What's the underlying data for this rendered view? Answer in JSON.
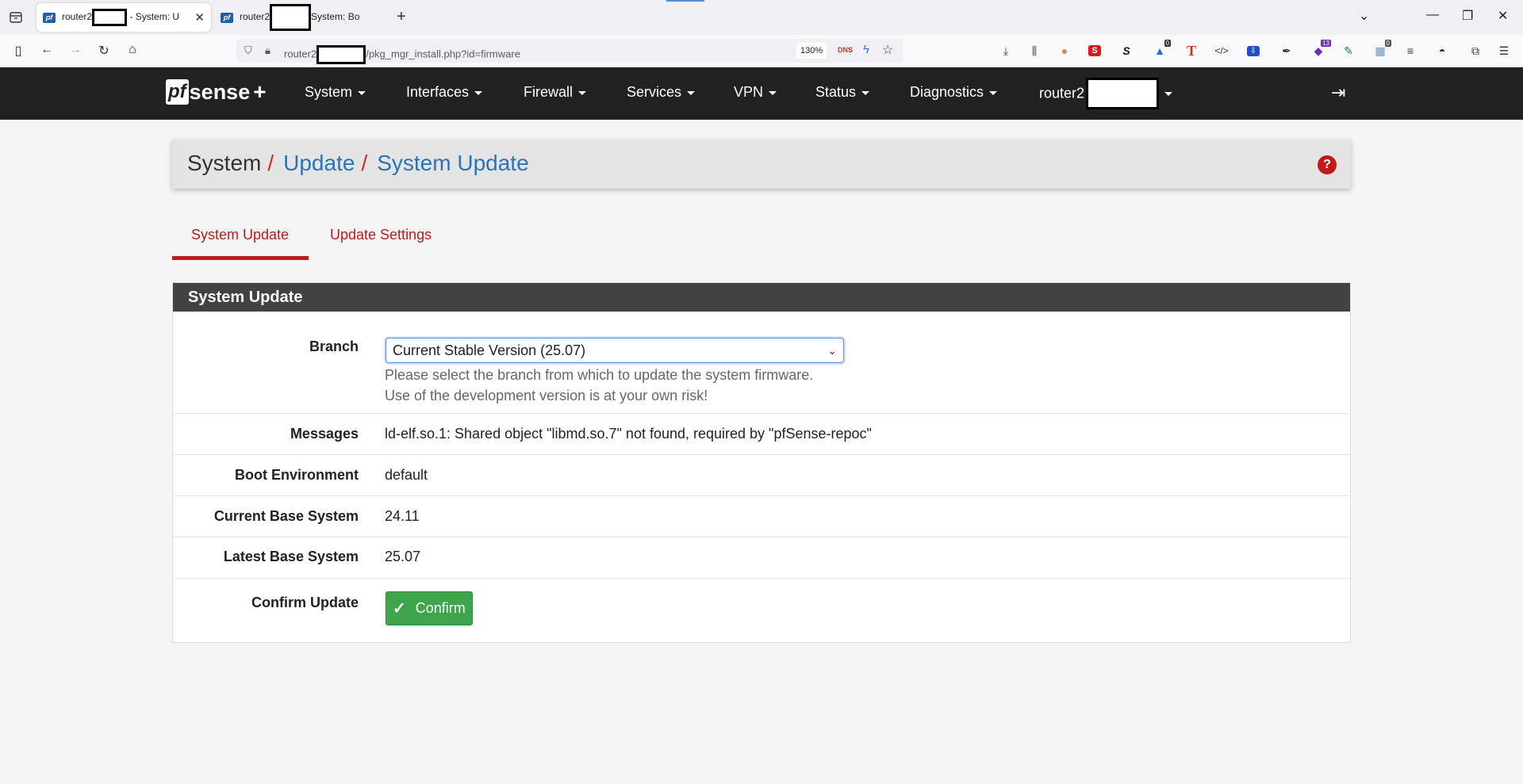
{
  "browser": {
    "tabs": [
      {
        "prefix": "router2",
        "suffix": " - System: U",
        "active": true,
        "favicon": "pf"
      },
      {
        "prefix": "router2",
        "suffix": "System: Bo",
        "active": false,
        "favicon": "pf"
      }
    ],
    "url_prefix": "router2",
    "url_suffix": "/pkg_mgr_install.php?id=firmware",
    "zoom": "130%",
    "dns_badge": "DNS",
    "badge_one": "0",
    "badge_two": "13",
    "badge_three": "0"
  },
  "header": {
    "logo_pf": "pf",
    "logo_sense": "sense",
    "logo_plus": "+",
    "menu": [
      "System",
      "Interfaces",
      "Firewall",
      "Services",
      "VPN",
      "Status",
      "Diagnostics"
    ],
    "hostname_prefix": "router2"
  },
  "breadcrumb": {
    "root": "System",
    "sep": "/",
    "level1": "Update",
    "level2": "System Update",
    "help": "?"
  },
  "tabs": {
    "active": "System Update",
    "inactive": "Update Settings"
  },
  "panel": {
    "title": "System Update",
    "rows": {
      "branch_label": "Branch",
      "branch_value": "Current Stable Version (25.07)",
      "branch_help_1": "Please select the branch from which to update the system firmware.",
      "branch_help_2": "Use of the development version is at your own risk!",
      "messages_label": "Messages",
      "messages_value": "ld-elf.so.1: Shared object \"libmd.so.7\" not found, required by \"pfSense-repoc\"",
      "boot_label": "Boot Environment",
      "boot_value": "default",
      "current_label": "Current Base System",
      "current_value": "24.11",
      "latest_label": "Latest Base System",
      "latest_value": "25.07",
      "confirm_label": "Confirm Update",
      "confirm_button": "Confirm"
    }
  },
  "colors": {
    "header_bg": "#212121",
    "accent_red": "#c11a1a",
    "link_blue": "#2b73b8",
    "confirm_green": "#3ea54a",
    "panel_head": "#424242"
  }
}
